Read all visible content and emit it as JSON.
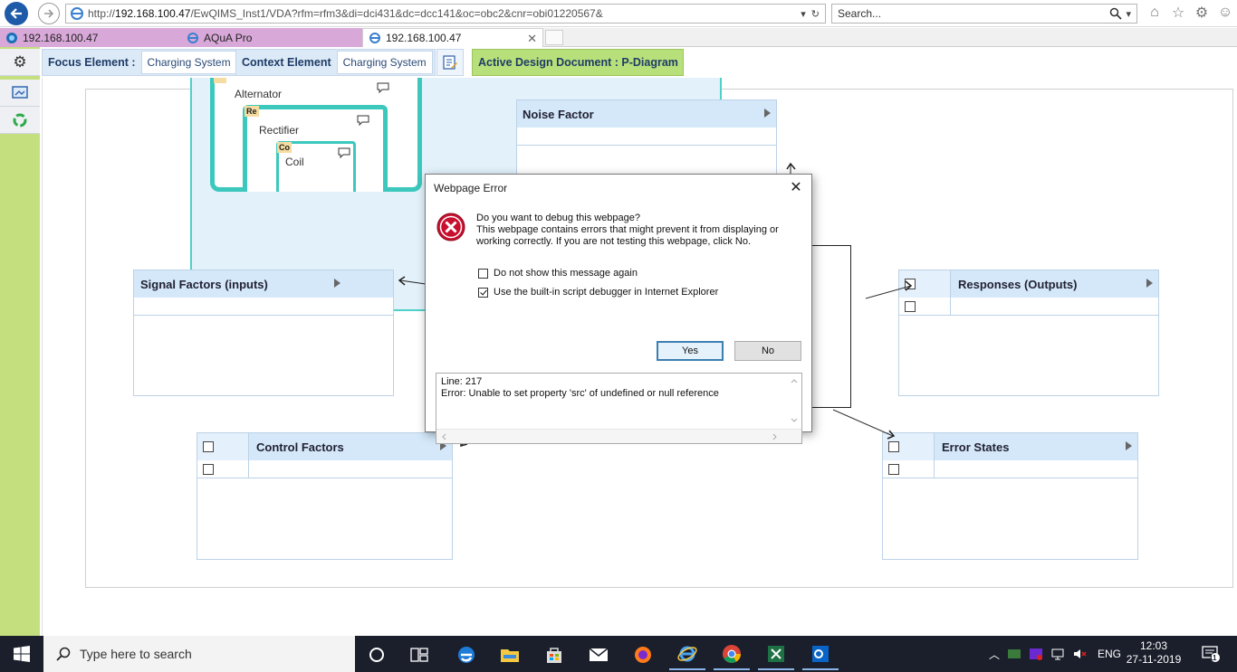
{
  "browser": {
    "url_prefix": "http://",
    "url_host": "192.168.100.47",
    "url_path": "/EwQIMS_Inst1/VDA?rfm=rfm3&di=dci431&dc=dcc141&oc=obc2&cnr=obi01220567&",
    "search_placeholder": "Search...",
    "tabs": [
      {
        "label": "192.168.100.47"
      },
      {
        "label": "AQuA Pro"
      },
      {
        "label": "192.168.100.47"
      }
    ]
  },
  "header": {
    "focus_label": "Focus Element :",
    "focus_value": "Charging System",
    "context_label": "Context Element",
    "context_value": "Charging System",
    "active_doc": "Active Design Document : P-Diagram"
  },
  "system": {
    "alternator": {
      "label": "Alternator"
    },
    "rectifier": {
      "tag": "Re",
      "label": "Rectifier"
    },
    "coil": {
      "tag": "Co",
      "label": "Coil"
    }
  },
  "panels": {
    "noise": "Noise Factor",
    "signal": "Signal Factors (inputs)",
    "responses": "Responses (Outputs)",
    "control": "Control Factors",
    "errors": "Error States"
  },
  "dialog": {
    "title": "Webpage Error",
    "question": "Do you want to debug this webpage?",
    "description": "This webpage contains errors that might prevent it from displaying or working correctly. If you are not testing this webpage, click No.",
    "option1": "Do not show this message again",
    "option2": "Use the built-in script debugger in Internet Explorer",
    "yes": "Yes",
    "no": "No",
    "detail": "Line: 217\nError: Unable to set property 'src' of undefined or null reference"
  },
  "taskbar": {
    "search_placeholder": "Type here to search",
    "lang": "ENG",
    "time": "12:03",
    "date": "27-11-2019",
    "notifications": "11"
  },
  "colors": {
    "sidebar": "#c4e07e",
    "accent_teal": "#3cc8bd",
    "panel_header": "#d4e8fa",
    "active_doc": "#b8e07a"
  }
}
